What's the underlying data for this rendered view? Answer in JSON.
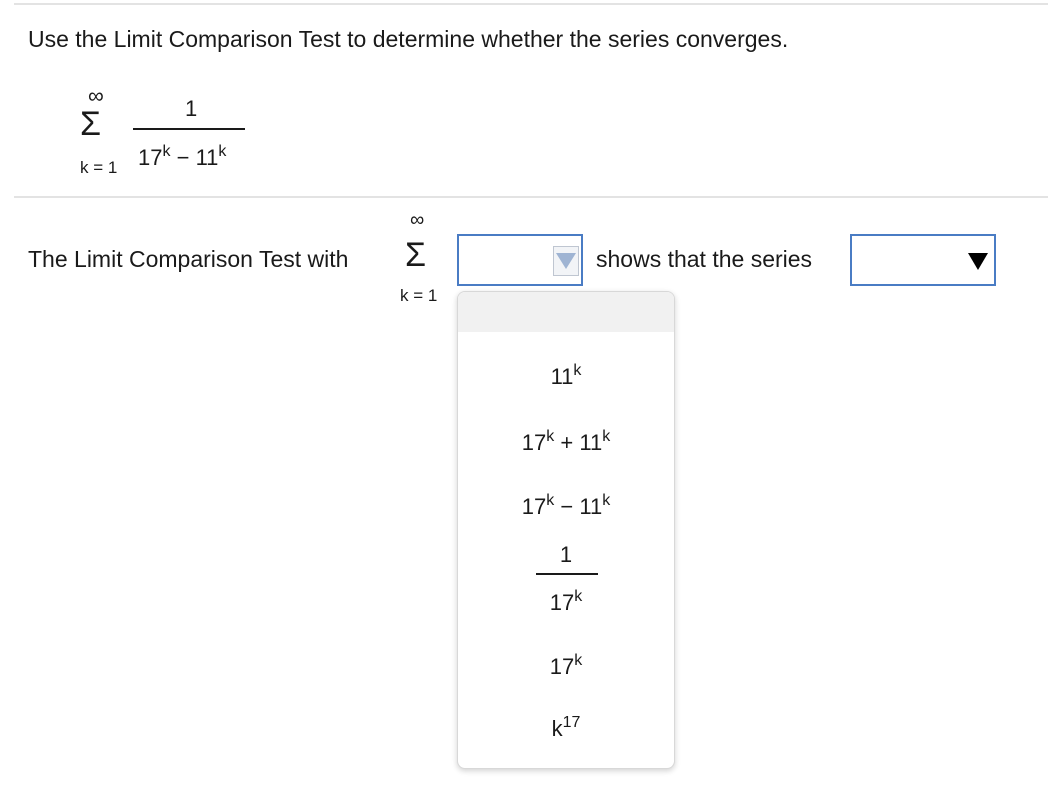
{
  "question": {
    "instruction": "Use the Limit Comparison Test to determine whether the series converges."
  },
  "series": {
    "upper_limit": "∞",
    "sigma": "Σ",
    "lower_limit": "k = 1",
    "numerator": "1",
    "denominator": {
      "base1": "17",
      "exp1": "k",
      "op": " − ",
      "base2": "11",
      "exp2": "k"
    }
  },
  "comparison_line": {
    "lead_text": "The Limit Comparison Test with",
    "upper_limit": "∞",
    "sigma": "Σ",
    "lower_limit": "k = 1",
    "mid_text": "shows that the series",
    "select1_value": "",
    "select2_value": ""
  },
  "dropdown_options": {
    "opt1": {
      "base": "11",
      "exp": "k"
    },
    "opt2": {
      "base1": "17",
      "exp1": "k",
      "op": " + ",
      "base2": "11",
      "exp2": "k"
    },
    "opt3": {
      "base1": "17",
      "exp1": "k",
      "op": " − ",
      "base2": "11",
      "exp2": "k"
    },
    "opt4": {
      "numerator": "1",
      "den_base": "17",
      "den_exp": "k"
    },
    "opt5": {
      "base": "17",
      "exp": "k"
    },
    "opt6": {
      "base": "k",
      "exp": "17"
    }
  },
  "icons": {
    "select1_arrow": "dropdown-arrow-icon",
    "select2_arrow": "dropdown-arrow-icon"
  },
  "colors": {
    "select_border": "#4a7cc4",
    "arrow_light": "#9fb4d3",
    "arrow_dark": "#000000"
  }
}
